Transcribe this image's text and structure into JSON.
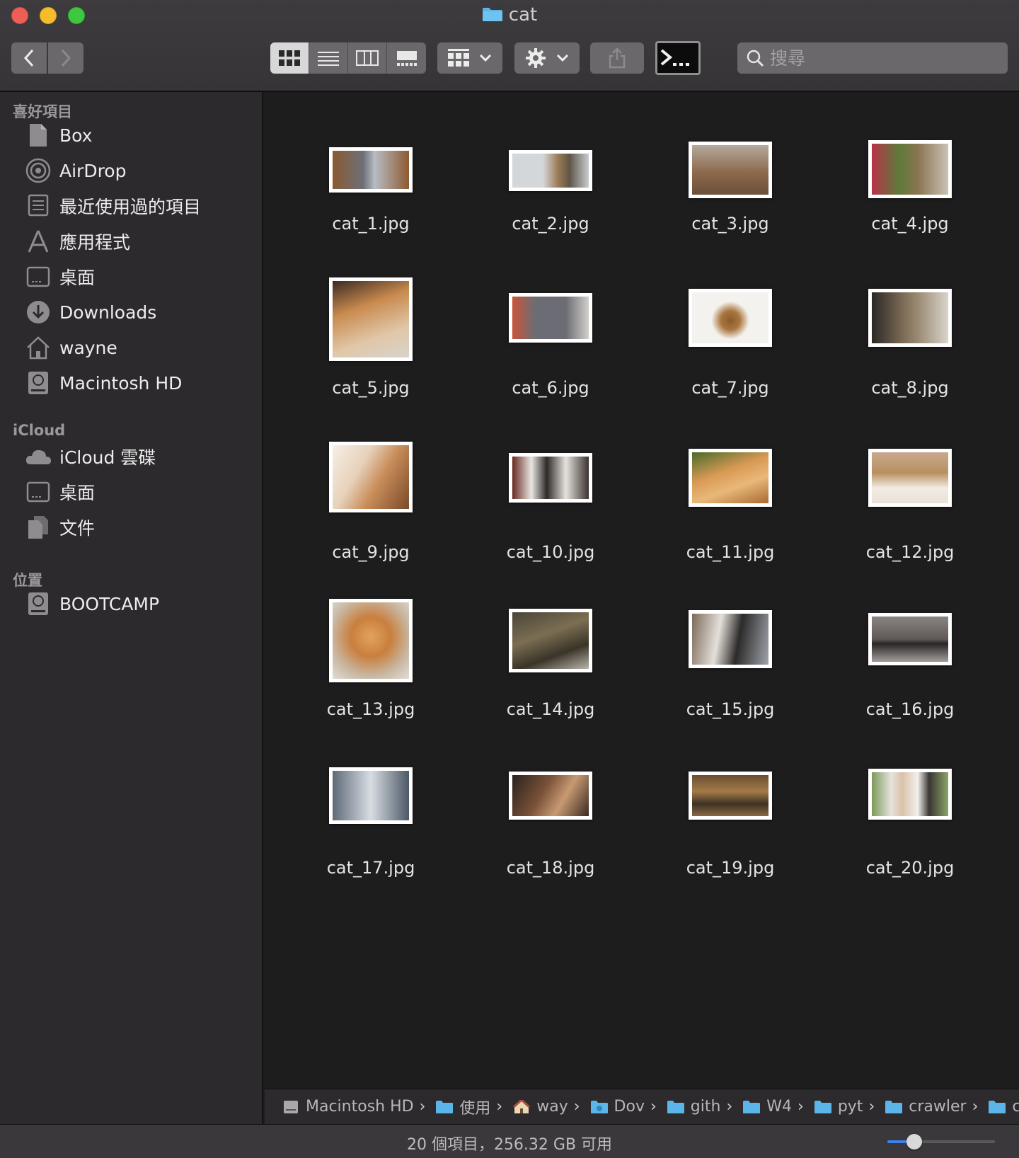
{
  "window": {
    "title": "cat",
    "traffic_colors": {
      "close": "#ee5e56",
      "minimize": "#f5bd2e",
      "zoom": "#3fc83f"
    }
  },
  "toolbar": {
    "back_icon": "chevron-left-icon",
    "forward_icon": "chevron-right-icon",
    "view_modes": [
      "icon-view",
      "list-view",
      "column-view",
      "gallery-view"
    ],
    "active_view": "icon-view",
    "group_icon": "group-grid-icon",
    "action_icon": "gear-icon",
    "share_icon": "share-icon",
    "terminal_icon": "terminal-icon",
    "search_placeholder": "搜尋"
  },
  "sidebar": {
    "favorites_header": "喜好項目",
    "favorites": [
      {
        "label": "Box",
        "icon": "document-icon"
      },
      {
        "label": "AirDrop",
        "icon": "airdrop-icon"
      },
      {
        "label": "最近使用過的項目",
        "icon": "recents-icon"
      },
      {
        "label": "應用程式",
        "icon": "applications-icon"
      },
      {
        "label": "桌面",
        "icon": "desktop-icon"
      },
      {
        "label": "Downloads",
        "icon": "downloads-icon"
      },
      {
        "label": "wayne",
        "icon": "home-icon"
      },
      {
        "label": "Macintosh HD",
        "icon": "disk-icon"
      }
    ],
    "icloud_header": "iCloud",
    "icloud": [
      {
        "label": "iCloud 雲碟",
        "icon": "cloud-icon"
      },
      {
        "label": "桌面",
        "icon": "desktop-icon"
      },
      {
        "label": "文件",
        "icon": "documents-icon"
      }
    ],
    "locations_header": "位置",
    "locations": [
      {
        "label": "BOOTCAMP",
        "icon": "disk-icon"
      }
    ]
  },
  "files": [
    {
      "name": "cat_1.jpg"
    },
    {
      "name": "cat_2.jpg"
    },
    {
      "name": "cat_3.jpg"
    },
    {
      "name": "cat_4.jpg"
    },
    {
      "name": "cat_5.jpg"
    },
    {
      "name": "cat_6.jpg"
    },
    {
      "name": "cat_7.jpg"
    },
    {
      "name": "cat_8.jpg"
    },
    {
      "name": "cat_9.jpg"
    },
    {
      "name": "cat_10.jpg"
    },
    {
      "name": "cat_11.jpg"
    },
    {
      "name": "cat_12.jpg"
    },
    {
      "name": "cat_13.jpg"
    },
    {
      "name": "cat_14.jpg"
    },
    {
      "name": "cat_15.jpg"
    },
    {
      "name": "cat_16.jpg"
    },
    {
      "name": "cat_17.jpg"
    },
    {
      "name": "cat_18.jpg"
    },
    {
      "name": "cat_19.jpg"
    },
    {
      "name": "cat_20.jpg"
    }
  ],
  "pathbar": [
    {
      "label": "Macintosh HD",
      "icon": "disk-icon"
    },
    {
      "label": "使用",
      "icon": "folder-icon"
    },
    {
      "label": "way",
      "icon": "home-icon"
    },
    {
      "label": "Dov",
      "icon": "folder-icon"
    },
    {
      "label": "gith",
      "icon": "folder-icon"
    },
    {
      "label": "W4",
      "icon": "folder-icon"
    },
    {
      "label": "pyt",
      "icon": "folder-icon"
    },
    {
      "label": "crawler",
      "icon": "folder-icon"
    },
    {
      "label": "cat",
      "icon": "folder-icon"
    }
  ],
  "status": {
    "text": "20 個項目，256.32 GB 可用",
    "zoom_level": 0.25
  }
}
